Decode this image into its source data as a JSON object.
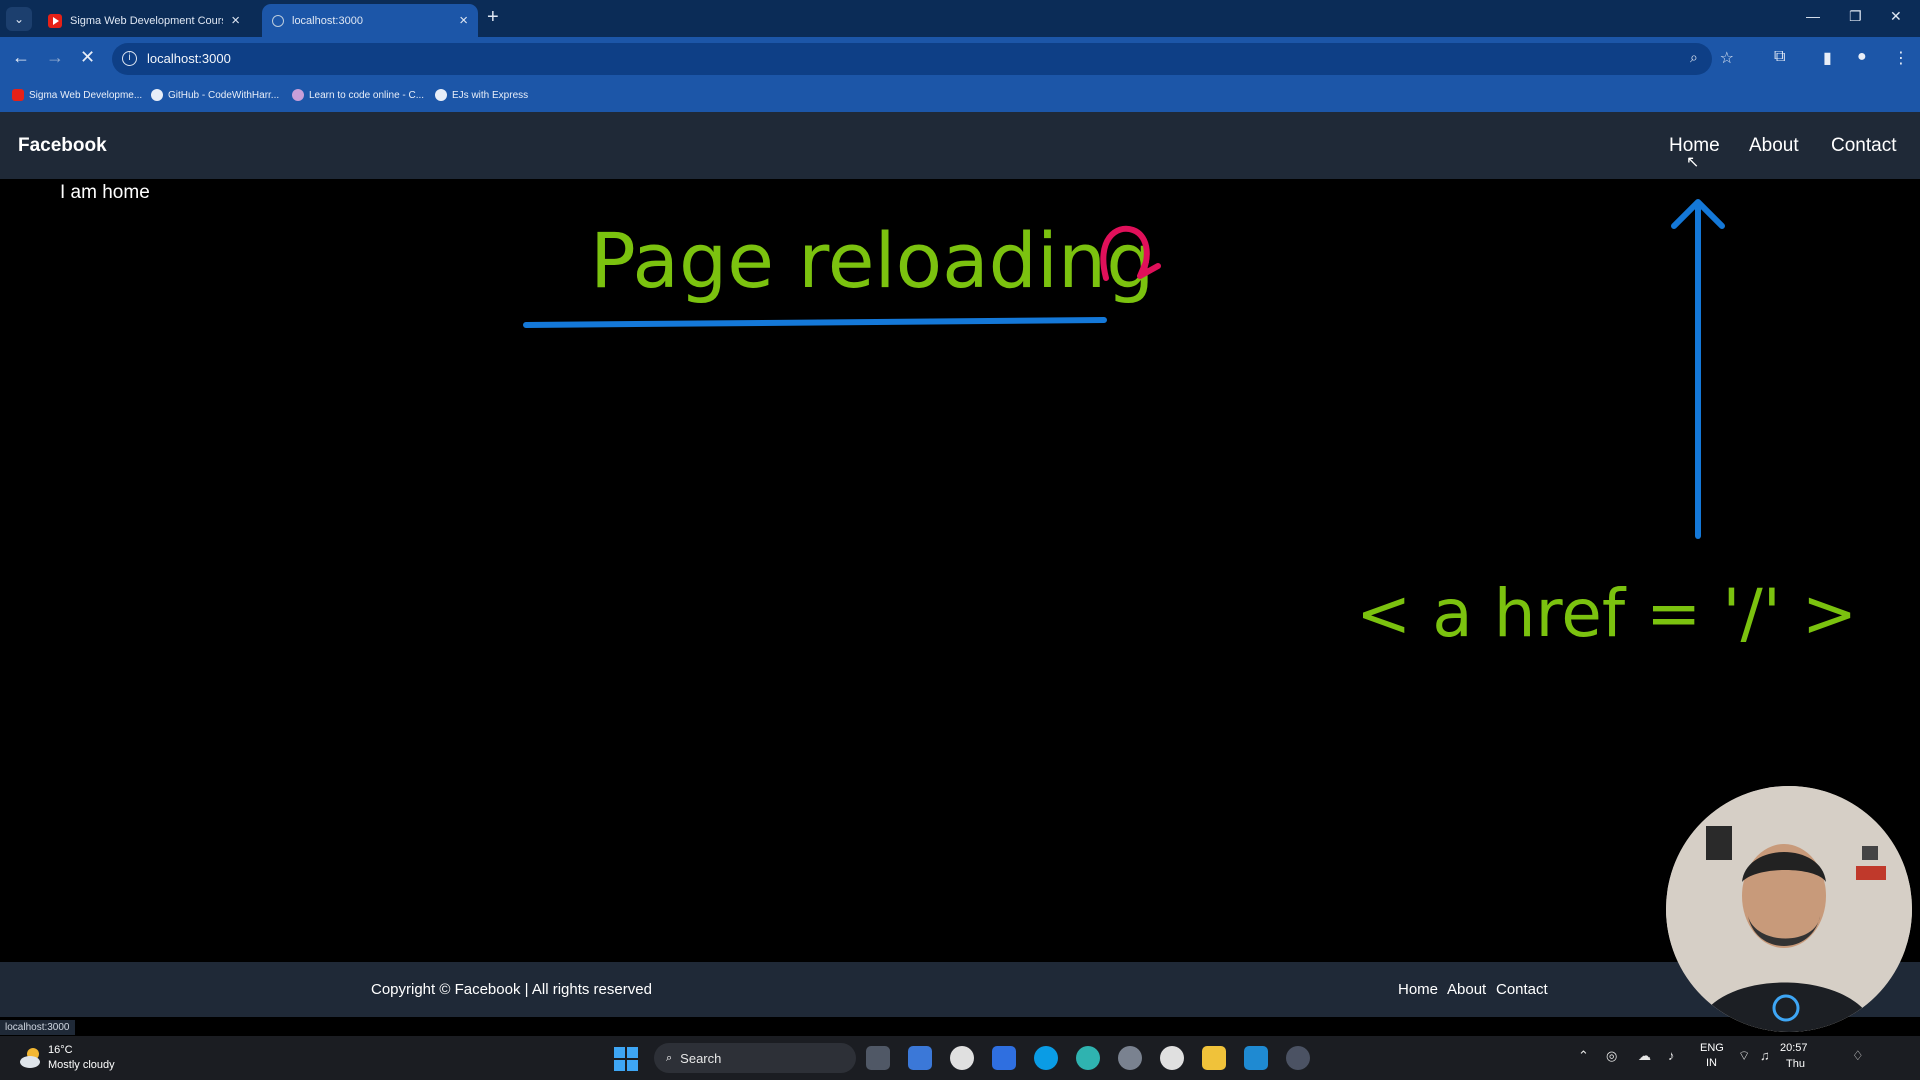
{
  "browser": {
    "tabs": [
      {
        "title": "Sigma Web Development Course - W",
        "favicon": "youtube-icon",
        "active": false
      },
      {
        "title": "localhost:3000",
        "favicon": "globe-icon",
        "active": true
      }
    ],
    "address": "localhost:3000",
    "bookmarks": [
      {
        "label": "Sigma Web Developme...",
        "icon": "youtube-icon"
      },
      {
        "label": "GitHub - CodeWithHarr...",
        "icon": "github-icon"
      },
      {
        "label": "Learn to code online - C...",
        "icon": "avatar-icon"
      },
      {
        "label": "EJs with Express",
        "icon": "github-icon"
      }
    ],
    "status_url": "localhost:3000"
  },
  "site": {
    "brand": "Facebook",
    "nav": [
      "Home",
      "About",
      "Contact"
    ],
    "body_text": "I am home",
    "footer": {
      "copyright": "Copyright © Facebook | All rights reserved",
      "links": [
        "Home",
        "About",
        "Contact"
      ]
    }
  },
  "annotations": {
    "title": "Page reloading",
    "code": "< a href = '/' >"
  },
  "taskbar": {
    "weather_temp": "16°C",
    "weather_condition": "Mostly cloudy",
    "search_label": "Search",
    "lang_line1": "ENG",
    "lang_line2": "IN",
    "time": "20:57",
    "day": "Thu"
  },
  "colors": {
    "tabstrip": "#0b2c57",
    "toolbar": "#1c56a8",
    "site_nav": "#1f2937",
    "annotation_green": "#7bc20f",
    "annotation_blue": "#1478d8",
    "annotation_pink": "#e0105a"
  }
}
